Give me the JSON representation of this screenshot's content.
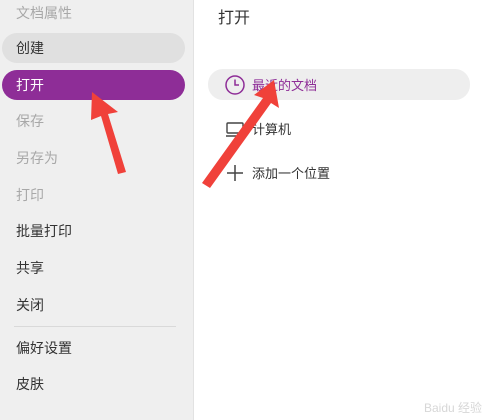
{
  "sidebar": {
    "items": [
      {
        "label": "文档属性",
        "state": "disabled"
      },
      {
        "label": "创建",
        "state": "hover"
      },
      {
        "label": "打开",
        "state": "selected"
      },
      {
        "label": "保存",
        "state": "disabled"
      },
      {
        "label": "另存为",
        "state": "disabled"
      },
      {
        "label": "打印",
        "state": "disabled"
      },
      {
        "label": "批量打印",
        "state": "normal"
      },
      {
        "label": "共享",
        "state": "normal"
      },
      {
        "label": "关闭",
        "state": "normal"
      },
      {
        "label": "偏好设置",
        "state": "normal"
      },
      {
        "label": "皮肤",
        "state": "normal"
      }
    ]
  },
  "main": {
    "title": "打开",
    "places": [
      {
        "label": "最近的文档",
        "icon": "clock-icon"
      },
      {
        "label": "计算机",
        "icon": "computer-icon"
      },
      {
        "label": "添加一个位置",
        "icon": "plus-icon"
      }
    ]
  },
  "colors": {
    "accent": "#8e2d97",
    "arrow": "#f0413a"
  },
  "watermark": "Baidu 经验"
}
